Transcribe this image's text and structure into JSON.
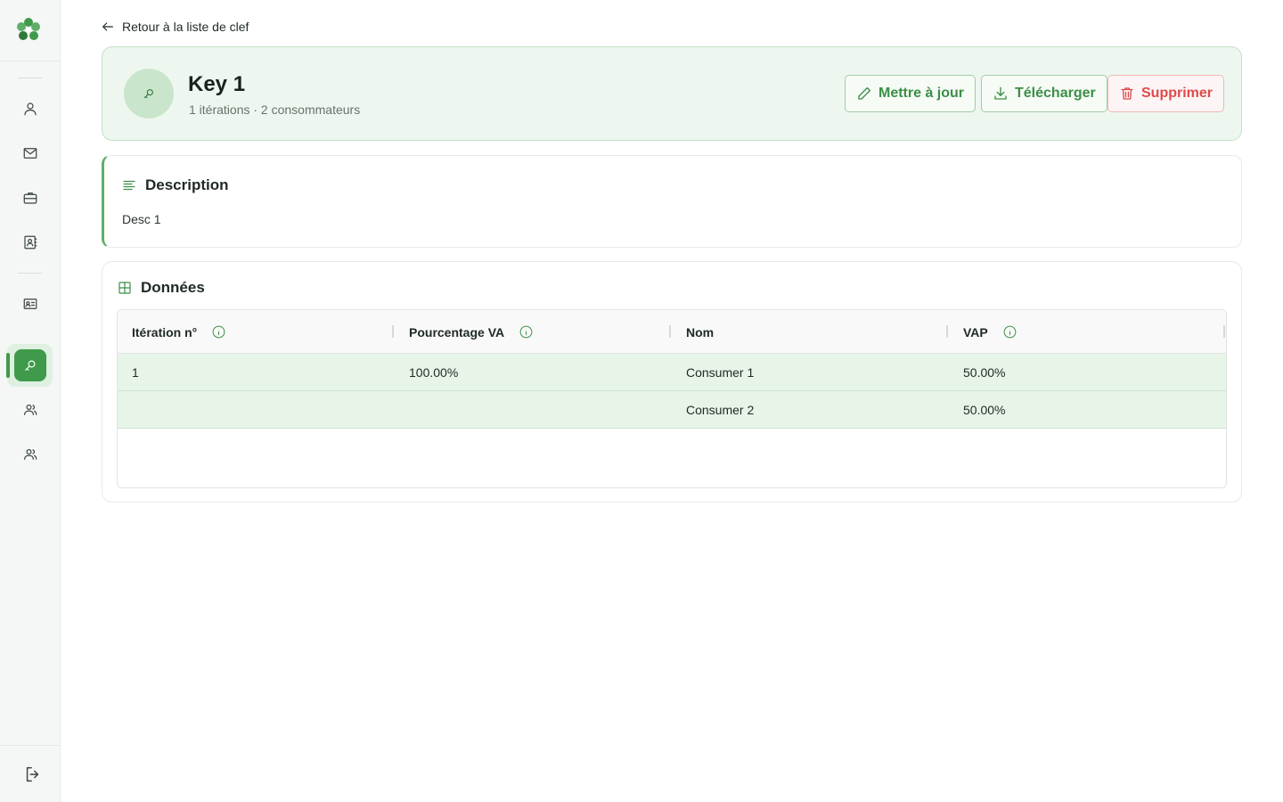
{
  "back_link": {
    "label": "Retour à la liste de clef"
  },
  "key": {
    "title": "Key 1",
    "subtitle": "1 itérations · 2 consommateurs"
  },
  "actions": {
    "update_label": "Mettre à jour",
    "download_label": "Télécharger",
    "delete_label": "Supprimer"
  },
  "description": {
    "heading": "Description",
    "text": "Desc 1"
  },
  "data_section": {
    "heading": "Données",
    "columns": [
      "Itération n°",
      "Pourcentage VA",
      "Nom",
      "VAP"
    ],
    "rows": [
      {
        "iteration": "1",
        "percentage": "100.00%",
        "name": "Consumer 1",
        "vap": "50.00%"
      },
      {
        "iteration": "",
        "percentage": "",
        "name": "Consumer 2",
        "vap": "50.00%"
      }
    ]
  },
  "sidebar": {
    "items": [
      "user-icon",
      "mail-icon",
      "briefcase-icon",
      "contact-book-icon",
      "id-card-icon",
      "key-icon",
      "users-icon",
      "users-group-icon"
    ],
    "active": "key-icon"
  },
  "colors": {
    "accent": "#3f9a4b",
    "danger": "#de4b4b",
    "row_highlight": "#e7f4e8"
  }
}
